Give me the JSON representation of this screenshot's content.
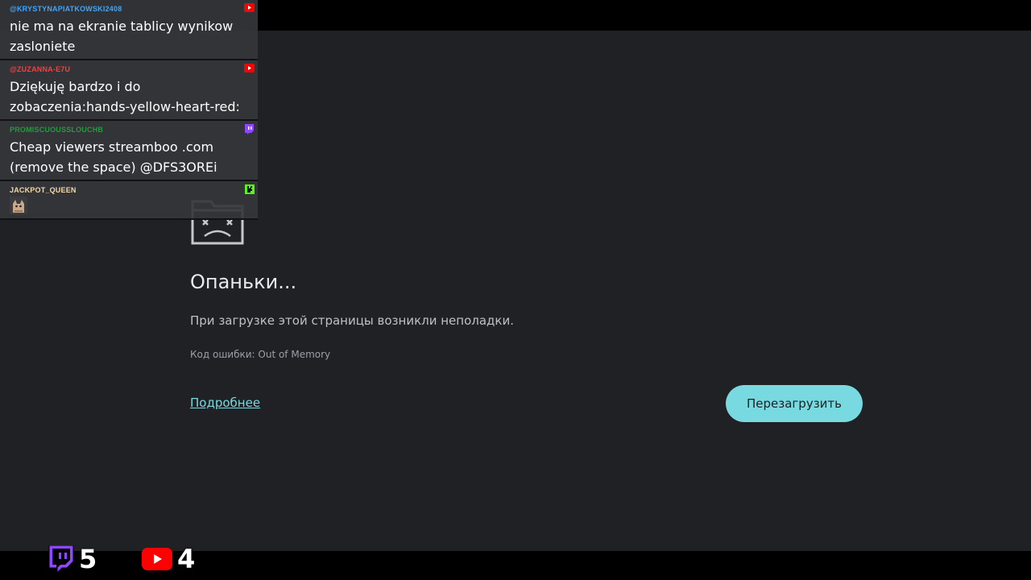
{
  "error_page": {
    "title": "Опаньки...",
    "message": "При загрузке этой страницы возникли неполадки.",
    "error_code": "Код ошибки: Out of Memory",
    "learn_more": "Подробнее",
    "reload_button": "Перезагрузить",
    "icon": "sad-folder-icon"
  },
  "chat": {
    "messages": [
      {
        "user": "@KRYSTYNAPIATKOWSKI2408",
        "text": "nie ma na ekranie tablicy wynikow zasloniete",
        "platform": "youtube",
        "user_color": "#3ea6ff"
      },
      {
        "user": "@ZUZANNA-E7U",
        "text": "Dziękuję bardzo i do zobaczenia:hands-yellow-heart-red:",
        "platform": "youtube",
        "user_color": "#ff3c3c"
      },
      {
        "user": "PROMISCUOUSSLOUCHB",
        "text": "Cheap viewers streamboo .com (remove the space) @DFS3OREi",
        "platform": "twitch",
        "user_color": "#1f9e3a"
      },
      {
        "user": "JACKPOT_QUEEN",
        "text": "",
        "platform": "kick",
        "user_color": "#f5d9a8",
        "emote": "cat-emote"
      }
    ]
  },
  "stats": {
    "twitch_viewers": "5",
    "youtube_viewers": "4"
  },
  "colors": {
    "background": "#202124",
    "accent": "#78d9e0",
    "twitch": "#9146ff",
    "youtube": "#ff0000",
    "kick": "#53fc18"
  }
}
